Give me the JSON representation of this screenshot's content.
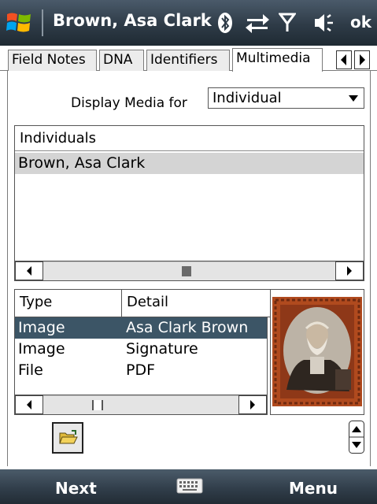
{
  "titlebar": {
    "title": "Brown, Asa Clark",
    "ok_label": "ok",
    "icons": [
      "windows-start-icon",
      "bluetooth-icon",
      "sync-arrows-icon",
      "signal-icon",
      "volume-icon"
    ]
  },
  "tabs": [
    {
      "label": "Field Notes",
      "active": false
    },
    {
      "label": "DNA",
      "active": false
    },
    {
      "label": "Identifiers",
      "active": false
    },
    {
      "label": "Multimedia",
      "active": true
    }
  ],
  "display_media": {
    "label": "Display Media for",
    "selected": "Individual"
  },
  "individuals": {
    "header": "Individuals",
    "rows": [
      "Brown, Asa Clark"
    ],
    "selected_index": 0
  },
  "media": {
    "columns": [
      "Type",
      "Detail"
    ],
    "rows": [
      {
        "type": "Image",
        "detail": "Asa Clark Brown"
      },
      {
        "type": "Image",
        "detail": "Signature"
      },
      {
        "type": "File",
        "detail": "PDF"
      }
    ],
    "selected_index": 0
  },
  "softkeys": {
    "left": "Next",
    "right": "Menu"
  },
  "colors": {
    "titlebar": "#2e3b47",
    "selection": "#3c5566",
    "list_highlight": "#d4d4d4",
    "photo_frame": "#b04a1e"
  }
}
